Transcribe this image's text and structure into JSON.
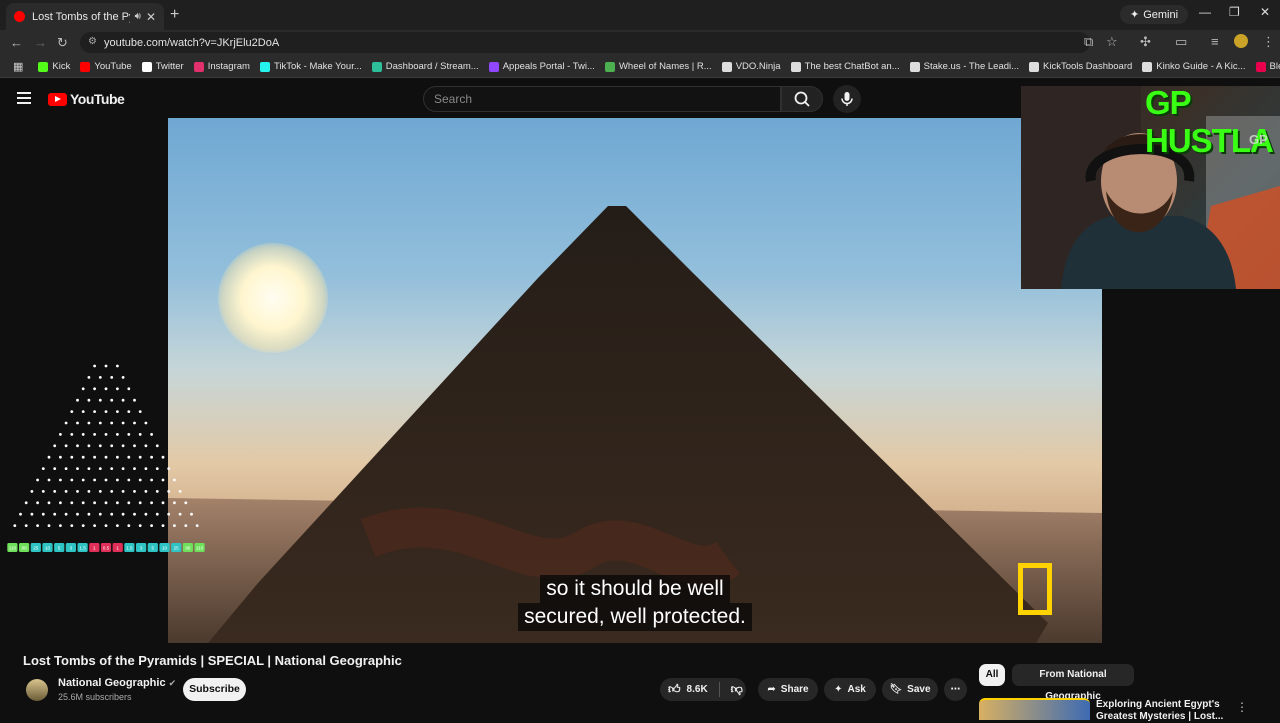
{
  "browser": {
    "tab_title": "Lost Tombs of the Pyramids | SPECIAL | National Geographic",
    "gemini_label": "Gemini",
    "url": "youtube.com/watch?v=JKrjElu2DoA",
    "bookmarks": [
      {
        "label": "Kick",
        "color": "#53fc18"
      },
      {
        "label": "YouTube",
        "color": "#ff0000"
      },
      {
        "label": "Twitter",
        "color": "#ffffff"
      },
      {
        "label": "Instagram",
        "color": "#e1306c"
      },
      {
        "label": "TikTok - Make Your...",
        "color": "#25f4ee"
      },
      {
        "label": "Dashboard / Stream...",
        "color": "#2dbe9a"
      },
      {
        "label": "Appeals Portal - Twi...",
        "color": "#9146ff"
      },
      {
        "label": "Wheel of Names | R...",
        "color": "#4caf50"
      },
      {
        "label": "VDO.Ninja",
        "color": "#dddddd"
      },
      {
        "label": "The best ChatBot an...",
        "color": "#dddddd"
      },
      {
        "label": "Stake.us - The Leadi...",
        "color": "#dddddd"
      },
      {
        "label": "KickTools Dashboard",
        "color": "#dddddd"
      },
      {
        "label": "Kinko Guide - A Kic...",
        "color": "#dddddd"
      },
      {
        "label": "Blerp Memes | Best...",
        "color": "#e8004c"
      }
    ]
  },
  "youtube": {
    "logo_text": "YouTube",
    "search_placeholder": "Search",
    "caption_line1": "so it should be well",
    "caption_line2": "secured, well protected.",
    "video_title": "Lost Tombs of the Pyramids | SPECIAL | National Geographic",
    "channel_name": "National Geographic",
    "subscribers": "25.6M subscribers",
    "subscribe_label": "Subscribe",
    "likes": "8.6K",
    "share_label": "Share",
    "ask_label": "Ask",
    "save_label": "Save",
    "chip_all": "All",
    "chip_channel": "From National Geographic",
    "rec_title": "Exploring Ancient Egypt's Greatest Mysteries | Lost..."
  },
  "overlay": {
    "cam_text": "GP HUSTLA",
    "cam_badge": "GP",
    "plinko_multipliers": [
      "110",
      "88",
      "25",
      "10",
      "5",
      "3",
      "1.5",
      "1",
      "0.5",
      "1",
      "1.5",
      "3",
      "5",
      "10",
      "25",
      "88",
      "110"
    ]
  },
  "colors": {
    "accent": "#ff0000",
    "natgeo": "#ffd200",
    "cam_text": "#39ff14"
  }
}
